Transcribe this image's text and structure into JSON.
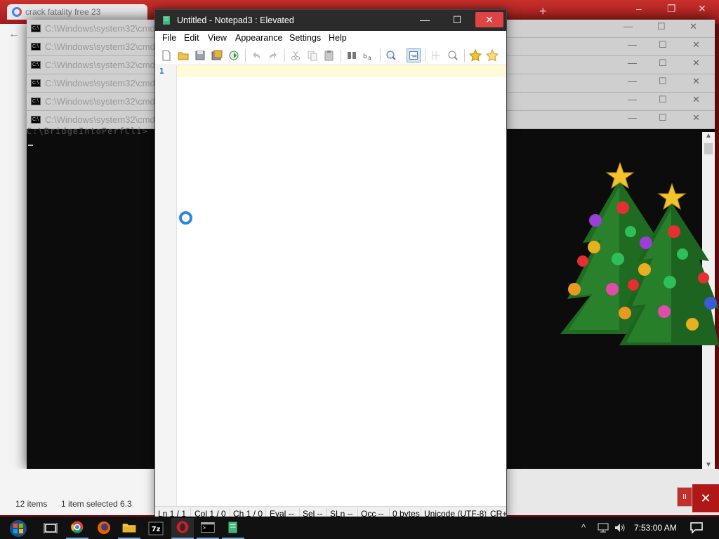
{
  "background": {
    "browser_tab": "crack fatality free 23",
    "cmd_title": "C:\\Windows\\system32\\cmd.exe",
    "cmd_prompt": "C:\\BridgeIntoPerfCli>",
    "explorer_items": "12 items",
    "explorer_selected": "1 item selected  6.3"
  },
  "notepad": {
    "title": "Untitled - Notepad3 : Elevated",
    "menu": [
      "File",
      "Edit",
      "View",
      "Appearance",
      "Settings",
      "Help"
    ],
    "toolbar": [
      "new-file-icon",
      "open-folder-icon",
      "save-icon",
      "save-as-icon",
      "revert-icon",
      "undo-icon",
      "redo-icon",
      "cut-icon",
      "copy-icon",
      "paste-icon",
      "find-icon",
      "replace-icon",
      "zoom-icon",
      "word-wrap-icon",
      "column-icon",
      "zoom-in-icon",
      "favorite-icon",
      "add-favorite-icon"
    ],
    "line_number": "1",
    "status": {
      "ln": "Ln  1 / 1",
      "col": "Col  1 / 0",
      "ch": "Ch  1 / 0",
      "eval": "Eval  --",
      "sel": "Sel  --",
      "sln": "SLn  --",
      "occ": "Occ  --",
      "bytes": "0 bytes",
      "encoding": "Unicode (UTF-8)",
      "eol": "CR+"
    }
  },
  "taskbar": {
    "apps": [
      "task-view-icon",
      "chrome-icon",
      "firefox-icon",
      "file-explorer-icon",
      "7zip-icon",
      "opera-icon",
      "cmd-icon",
      "notepad3-icon"
    ],
    "clock": "7:53:00 AM",
    "sevenzip_label": "7z"
  },
  "colors": {
    "accent": "#2b87d9",
    "titlebar": "#2b2b2b",
    "close": "#e04343",
    "current_line": "#fffbd6"
  }
}
